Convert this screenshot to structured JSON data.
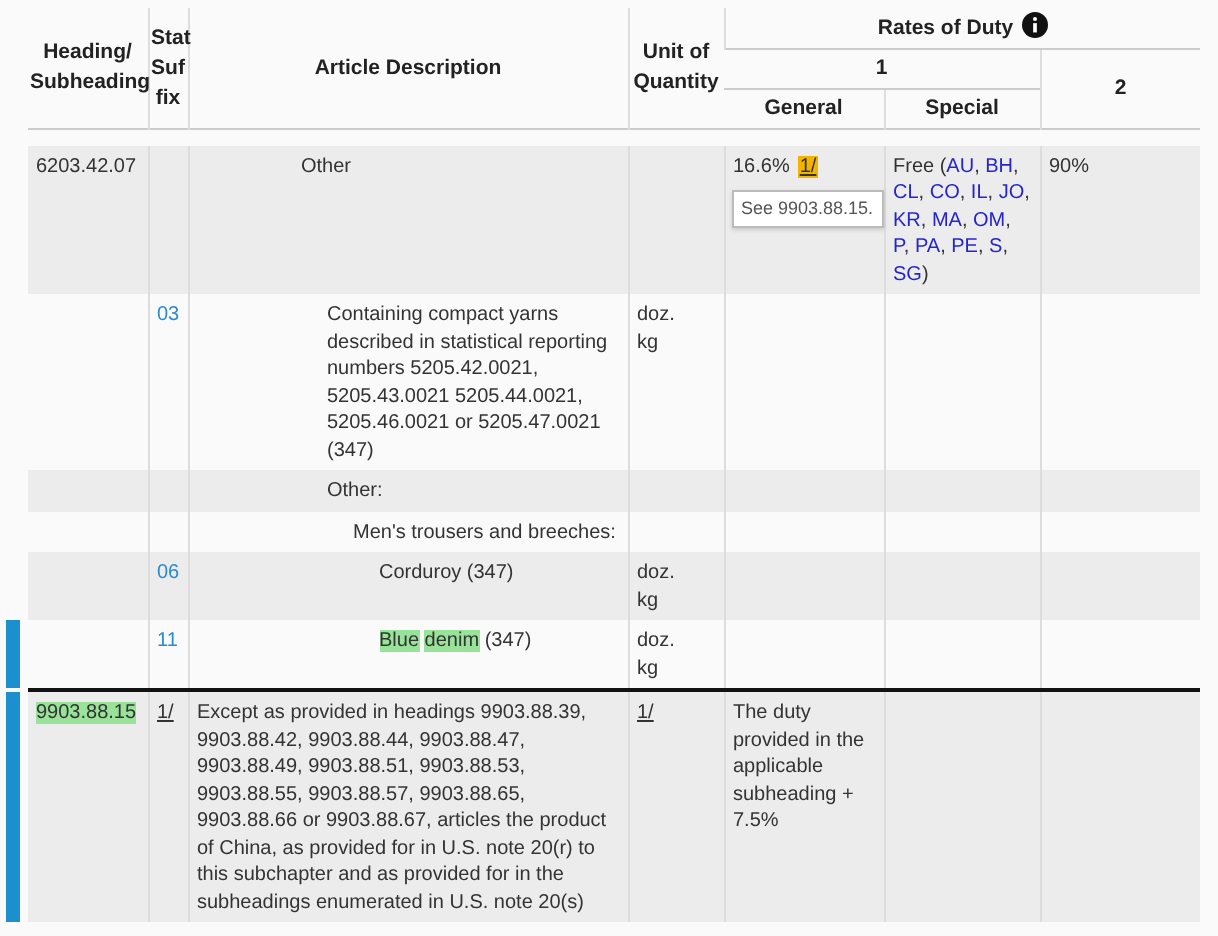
{
  "header": {
    "heading": "Heading/ Subheading",
    "stat_suffix": "Stat Suf fix",
    "description": "Article Description",
    "unit": "Unit of Quantity",
    "rates": "Rates of Duty",
    "column_1": "1",
    "general": "General",
    "special": "Special",
    "column_2": "2"
  },
  "rows": [
    {
      "heading": "6203.42.07",
      "flagged": false,
      "description": [
        {
          "text": "Other",
          "highlighted": false
        }
      ],
      "general": "16.6%",
      "footnote": "1/",
      "tooltip": "See 9903.88.15.",
      "special_prefix": "Free (",
      "special_codes": [
        "AU",
        "BH",
        "CL",
        "CO",
        "IL",
        "JO",
        "KR",
        "MA",
        "OM",
        "P",
        "PA",
        "PE",
        "S",
        "SG"
      ],
      "special_separator": ",",
      "special_suffix": ")",
      "column_2": "90%",
      "children": [
        {
          "suffix": "03",
          "flagged": false,
          "description": [
            {
              "text": "Containing compact yarns described in statistical reporting numbers 5205.42.0021, 5205.43.0021 5205.44.0021, 5205.46.0021 or 5205.47.0021 (347)",
              "highlighted": false
            }
          ],
          "unit": "doz. kg"
        },
        {
          "flagged": false,
          "description": [
            {
              "text": "Other:",
              "highlighted": false
            }
          ],
          "children": [
            {
              "flagged": false,
              "description": [
                {
                  "text": "Men's trousers and breeches:",
                  "highlighted": false
                }
              ],
              "children": [
                {
                  "suffix": "06",
                  "flagged": false,
                  "description": [
                    {
                      "text": "Corduroy (347)",
                      "highlighted": false
                    }
                  ],
                  "unit": "doz. kg"
                },
                {
                  "suffix": "11",
                  "flagged": true,
                  "description": [
                    {
                      "text": "Blue",
                      "highlighted": true
                    },
                    {
                      "text": "denim",
                      "highlighted": true
                    },
                    {
                      "text": "(347)",
                      "highlighted": false
                    }
                  ],
                  "unit": "doz. kg"
                }
              ]
            }
          ]
        }
      ]
    }
  ],
  "chapter99_rows": [
    {
      "heading": "9903.88.15",
      "heading_highlighted": true,
      "suffix": "1/",
      "flagged": true,
      "description": "Except as provided in headings 9903.88.39, 9903.88.42, 9903.88.44, 9903.88.47, 9903.88.49, 9903.88.51, 9903.88.53, 9903.88.55, 9903.88.57, 9903.88.65, 9903.88.66 or 9903.88.67, articles the product of China, as provided for in U.S. note 20(r) to this subchapter and as provided for in the subheadings enumerated in U.S. note 20(s)",
      "unit": "1/",
      "general": "The duty provided in the applicable subheading + 7.5%"
    }
  ]
}
